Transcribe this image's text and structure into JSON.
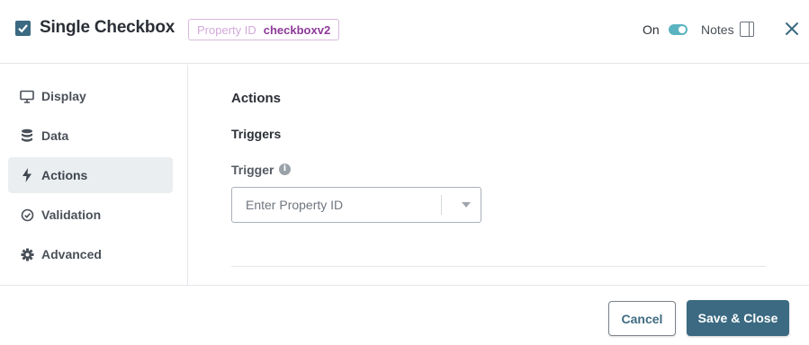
{
  "header": {
    "title": "Single Checkbox",
    "property_id_label": "Property ID",
    "property_id_value": "checkboxv2",
    "on_label": "On",
    "toggle_on": true,
    "notes_label": "Notes",
    "icons": {
      "component": "checkbox-icon",
      "notes": "panel-icon",
      "close": "close-icon"
    }
  },
  "sidebar": {
    "items": [
      {
        "label": "Display",
        "icon": "monitor-icon",
        "active": false
      },
      {
        "label": "Data",
        "icon": "database-icon",
        "active": false
      },
      {
        "label": "Actions",
        "icon": "lightning-icon",
        "active": true
      },
      {
        "label": "Validation",
        "icon": "check-circle-icon",
        "active": false
      },
      {
        "label": "Advanced",
        "icon": "gear-icon",
        "active": false
      }
    ]
  },
  "main": {
    "section_title": "Actions",
    "subsection_title": "Triggers",
    "trigger_label": "Trigger",
    "trigger_placeholder": "Enter Property ID"
  },
  "footer": {
    "cancel_label": "Cancel",
    "save_label": "Save & Close"
  },
  "colors": {
    "primary": "#3b6a82",
    "toggle": "#5ab3c0",
    "badge_value": "#8d3a99",
    "badge_label": "#d3a9da",
    "active_nav_bg": "#ebeef1"
  }
}
